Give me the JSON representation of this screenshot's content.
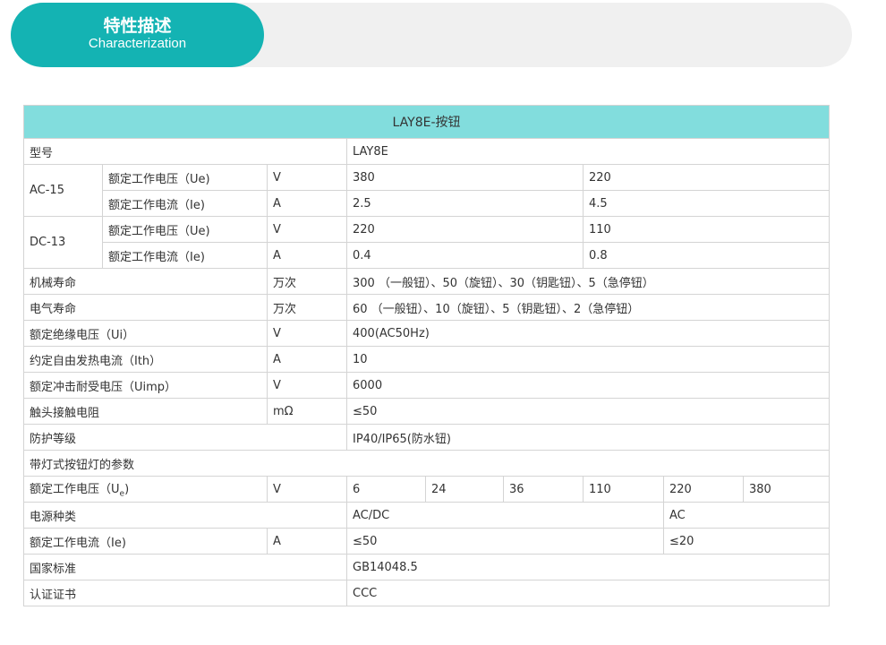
{
  "header": {
    "title_cn": "特性描述",
    "title_en": "Characterization"
  },
  "table": {
    "title": "LAY8E-按钮",
    "model_label": "型号",
    "model_value": "LAY8E",
    "ac15": {
      "label": "AC-15",
      "voltage_label": "额定工作电压（Ue)",
      "voltage_unit": "V",
      "voltage_values": [
        "380",
        "220"
      ],
      "current_label": "额定工作电流（Ie)",
      "current_unit": "A",
      "current_values": [
        "2.5",
        "4.5"
      ]
    },
    "dc13": {
      "label": "DC-13",
      "voltage_label": "额定工作电压（Ue)",
      "voltage_unit": "V",
      "voltage_values": [
        "220",
        "110"
      ],
      "current_label": "额定工作电流（Ie)",
      "current_unit": "A",
      "current_values": [
        "0.4",
        "0.8"
      ]
    },
    "mech_life": {
      "label": "机械寿命",
      "unit": "万次",
      "value": "300 （一般钮）、50（旋钮）、30（钥匙钮）、5（急停钮）"
    },
    "elec_life": {
      "label": "电气寿命",
      "unit": "万次",
      "value": "60 （一般钮）、10（旋钮）、5（钥匙钮）、2（急停钮）"
    },
    "insulation": {
      "label": "额定绝缘电压（Ui）",
      "unit": "V",
      "value": "400(AC50Hz)"
    },
    "thermal": {
      "label": "约定自由发热电流（Ith）",
      "unit": "A",
      "value": "10"
    },
    "impulse": {
      "label": "额定冲击耐受电压（Uimp）",
      "unit": "V",
      "value": "6000"
    },
    "contact_res": {
      "label": "触头接触电阻",
      "unit": "mΩ",
      "value": "≤50"
    },
    "protection": {
      "label": "防护等级",
      "value": "IP40/IP65(防水钮)"
    },
    "lamp_params": {
      "label": "带灯式按钮灯的参数"
    },
    "lamp_voltage": {
      "label_prefix": "额定工作电压（U",
      "label_sub": "e",
      "label_suffix": ")",
      "unit": "V",
      "values": [
        "6",
        "24",
        "36",
        "110",
        "220",
        "380"
      ]
    },
    "power_type": {
      "label": "电源种类",
      "value_1": "AC/DC",
      "value_2": "AC"
    },
    "lamp_current": {
      "label": "额定工作电流（Ie)",
      "unit": "A",
      "value_1": "≤50",
      "value_2": "≤20"
    },
    "standard": {
      "label": "国家标准",
      "value": "GB14048.5"
    },
    "certificate": {
      "label": "认证证书",
      "value": "CCC"
    }
  }
}
